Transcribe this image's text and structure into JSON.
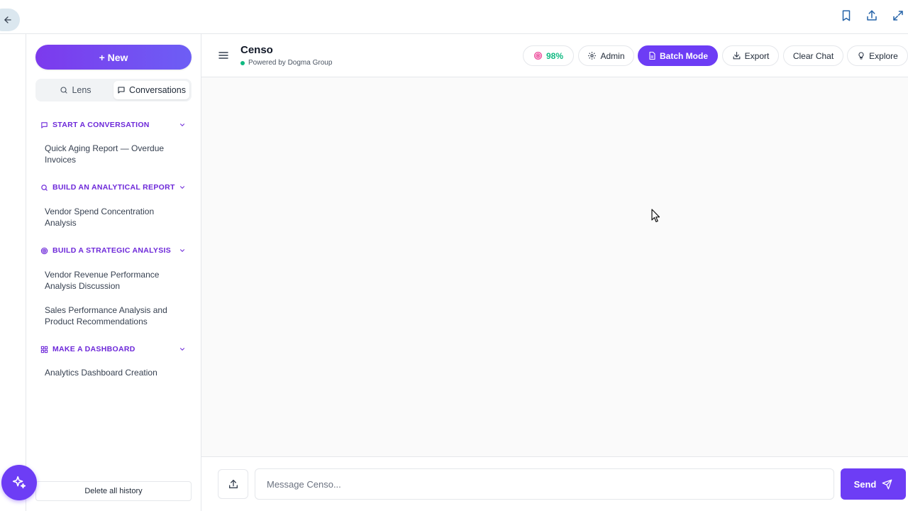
{
  "topbar": {
    "back_icon": "arrow-left-icon",
    "icons": [
      "bookmark-icon",
      "share-icon",
      "expand-icon"
    ]
  },
  "sidebar": {
    "new_button": "+ New",
    "tabs": [
      {
        "label": "Lens",
        "icon": "search-icon",
        "active": false
      },
      {
        "label": "Conversations",
        "icon": "chat-icon",
        "active": true
      }
    ],
    "sections": [
      {
        "title": "START A CONVERSATION",
        "icon": "chat-icon",
        "items": [
          "Quick Aging Report — Overdue Invoices"
        ]
      },
      {
        "title": "BUILD AN ANALYTICAL REPORT",
        "icon": "search-icon",
        "items": [
          "Vendor Spend Concentration Analysis"
        ]
      },
      {
        "title": "BUILD A STRATEGIC ANALYSIS",
        "icon": "target-icon",
        "items": [
          "Vendor Revenue Performance Analysis Discussion",
          "Sales Performance Analysis and Product Recommendations"
        ]
      },
      {
        "title": "MAKE A DASHBOARD",
        "icon": "grid-icon",
        "items": [
          "Analytics Dashboard Creation"
        ]
      }
    ],
    "delete_button": "Delete all history"
  },
  "header": {
    "title": "Censo",
    "subtitle": "Powered by Dogma Group",
    "status_color": "#10b981",
    "score": "98%",
    "score_color": "#10b981",
    "buttons": {
      "admin": "Admin",
      "batch": "Batch Mode",
      "export": "Export",
      "clear": "Clear Chat",
      "explore": "Explore"
    }
  },
  "composer": {
    "placeholder": "Message Censo...",
    "value": "",
    "send": "Send"
  },
  "colors": {
    "accent": "#6d3df5",
    "section_title": "#6d28d9"
  }
}
